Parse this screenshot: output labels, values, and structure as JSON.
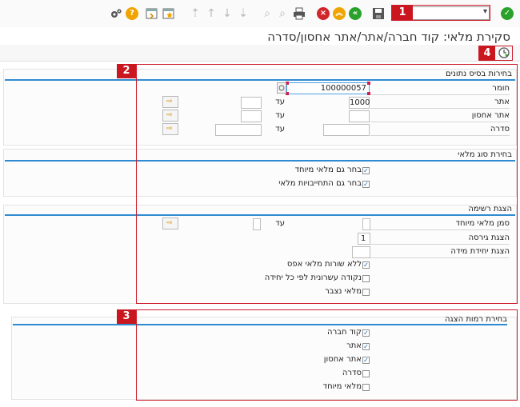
{
  "toolbar": {
    "icons": [
      "gear-icon",
      "help-icon",
      "layout-icon",
      "favorite-icon",
      "first-page-icon",
      "prev-page-icon",
      "next-page-icon",
      "last-page-icon",
      "find-icon",
      "find-next-icon",
      "print-icon",
      "save-icon",
      "cancel-icon",
      "exit-icon",
      "back-icon",
      "confirm-icon"
    ],
    "help_glyph": "?",
    "cancel_glyph": "×",
    "exit_glyph": "︽",
    "back_glyph": "«",
    "confirm_glyph": "✓",
    "command_value": ""
  },
  "callouts": [
    "1",
    "2",
    "3",
    "4"
  ],
  "page_title": "סקירת מלאי: קוד חברה/אתר/אתר אחסון/סדרה",
  "db_selection": {
    "title": "בחירות בסיס נתונים",
    "material_label": "חומר",
    "material_value": "100000057",
    "plant_label": "אתר",
    "plant_value": "1000",
    "sloc_label": "אתר אחסון",
    "batch_label": "סדרה",
    "to_label": "עד"
  },
  "stock_type": {
    "title": "בחירת סוג מלאי",
    "special_stock": "בחר גם מלאי מיוחד",
    "commitments": "בחר גם התחייבויות מלאי",
    "check_mark": "✓"
  },
  "list_display": {
    "title": "הצגת רשימה",
    "special_stock_ind": "סמן מלאי מיוחד",
    "to_label": "עד",
    "display_version": "הצגת גירסה",
    "display_version_value": "1",
    "display_uom": "הצגת יחידת מידה",
    "no_zero_lines": "ללא שורות מלאי אפס",
    "decimal_per_unit": "נקודה עשרונית לפי כל יחידה",
    "cumulative_stock": "מלאי נצבר"
  },
  "display_levels": {
    "title": "בחירת רמות הצגה",
    "items": [
      "קוד חברה",
      "אתר",
      "אתר אחסון",
      "סדרה",
      "מלאי מיוחד"
    ],
    "checked": [
      true,
      true,
      true,
      false,
      false
    ]
  }
}
